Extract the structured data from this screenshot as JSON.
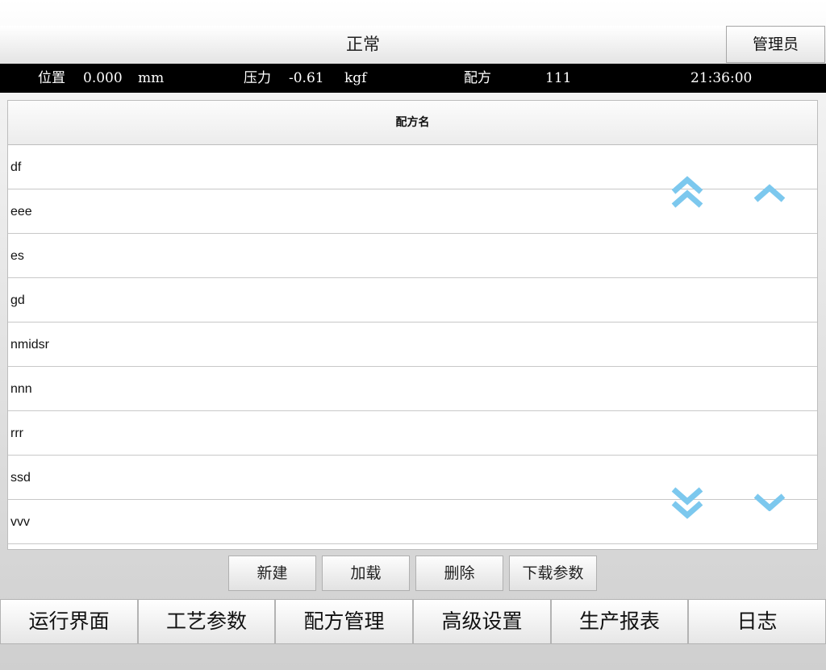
{
  "header": {
    "status": "正常",
    "user_role": "管理员"
  },
  "info_bar": {
    "position_label": "位置",
    "position_value": "0.000",
    "position_unit": "mm",
    "pressure_label": "压力",
    "pressure_value": "-0.61",
    "pressure_unit": "kgf",
    "recipe_label": "配方",
    "recipe_value": "111",
    "time": "21:36:00"
  },
  "table": {
    "column_header": "配方名",
    "rows": [
      "df",
      "eee",
      "es",
      "gd",
      "nmidsr",
      "nnn",
      "rrr",
      "ssd",
      "vvv"
    ]
  },
  "scroll_controls": {
    "color": "#7cc8ee",
    "icons": [
      "double-chevron-up-icon",
      "chevron-up-icon",
      "double-chevron-down-icon",
      "chevron-down-icon"
    ]
  },
  "actions": [
    "新建",
    "加载",
    "删除",
    "下载参数"
  ],
  "nav": [
    "运行界面",
    "工艺参数",
    "配方管理",
    "高级设置",
    "生产报表",
    "日志"
  ]
}
